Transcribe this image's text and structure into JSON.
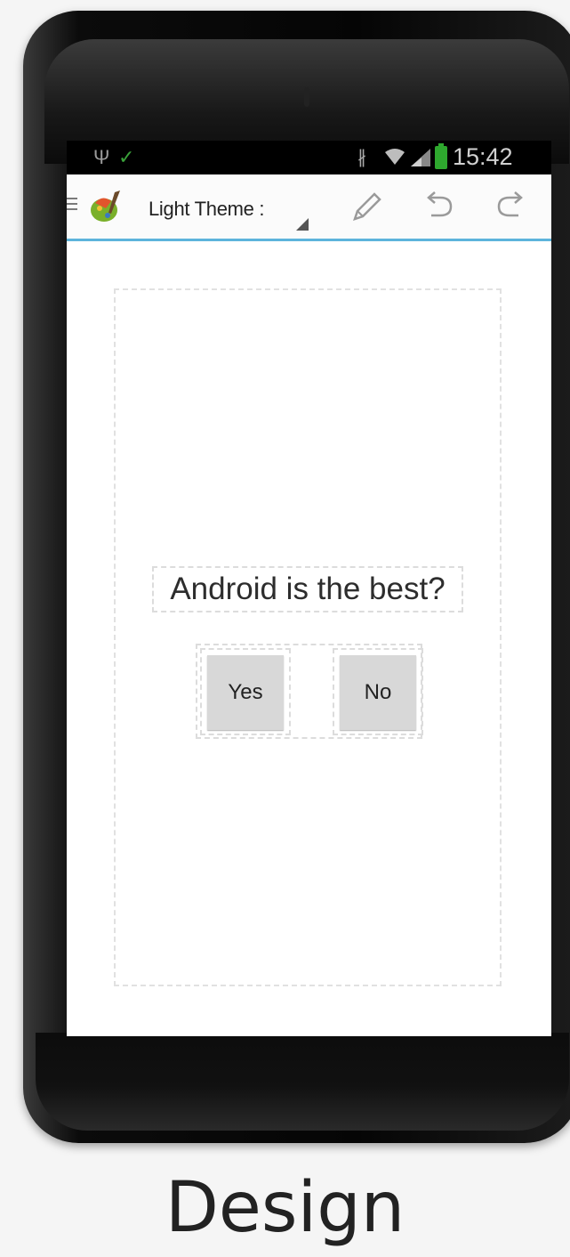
{
  "status_bar": {
    "time": "15:42",
    "icons": [
      "usb-icon",
      "check-icon",
      "bluetooth-icon",
      "wifi-icon",
      "signal-icon",
      "battery-icon"
    ]
  },
  "action_bar": {
    "title": "Light Theme :",
    "icons": [
      "menu-icon",
      "app-logo",
      "pencil-icon",
      "undo-icon",
      "redo-icon"
    ],
    "accent_color": "#5db4dc"
  },
  "content": {
    "question": "Android is the best?",
    "yes_label": "Yes",
    "no_label": "No"
  },
  "caption": "Design"
}
